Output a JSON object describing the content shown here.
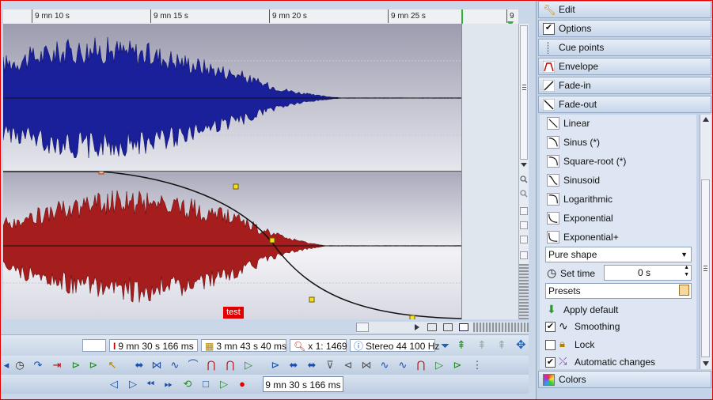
{
  "ruler": {
    "labels": [
      "9 mn 10 s",
      "9 mn 15 s",
      "9 mn 20 s",
      "9 mn 25 s",
      "9"
    ]
  },
  "marker": {
    "label": "test"
  },
  "status": {
    "empty": "",
    "position": "9 mn 30 s 166 ms",
    "length": "3 mn 43 s 40 ms",
    "zoom": "x 1: 1469",
    "format": "Stereo 44 100 Hz"
  },
  "transport": {
    "time": "9 mn 30 s 166 ms"
  },
  "panel": {
    "headers": [
      {
        "label": "Edit",
        "icon": "wrench-icon"
      },
      {
        "label": "Options",
        "icon": "checkbox-icon"
      },
      {
        "label": "Cue points",
        "icon": "cue-points-icon"
      },
      {
        "label": "Envelope",
        "icon": "envelope-icon"
      },
      {
        "label": "Fade-in",
        "icon": "fade-in-icon"
      },
      {
        "label": "Fade-out",
        "icon": "fade-out-icon"
      }
    ],
    "fade_shapes": [
      {
        "label": "Linear"
      },
      {
        "label": "Sinus (*)"
      },
      {
        "label": "Square-root (*)"
      },
      {
        "label": "Sinusoid"
      },
      {
        "label": "Logarithmic"
      },
      {
        "label": "Exponential"
      },
      {
        "label": "Exponential+"
      }
    ],
    "mode_select": "Pure shape",
    "set_time_label": "Set time",
    "set_time_value": "0 s",
    "presets_select": "Presets",
    "apply_default": "Apply default",
    "smoothing": {
      "label": "Smoothing",
      "checked": true
    },
    "lock": {
      "label": "Lock",
      "checked": false
    },
    "automatic_changes": {
      "label": "Automatic changes",
      "checked": true
    },
    "colors_header": "Colors"
  },
  "colors": {
    "top_channel": "#1a1f9a",
    "bottom_channel": "#a51d1d",
    "marker_bg": "#e00000",
    "frame": "#e00000"
  }
}
